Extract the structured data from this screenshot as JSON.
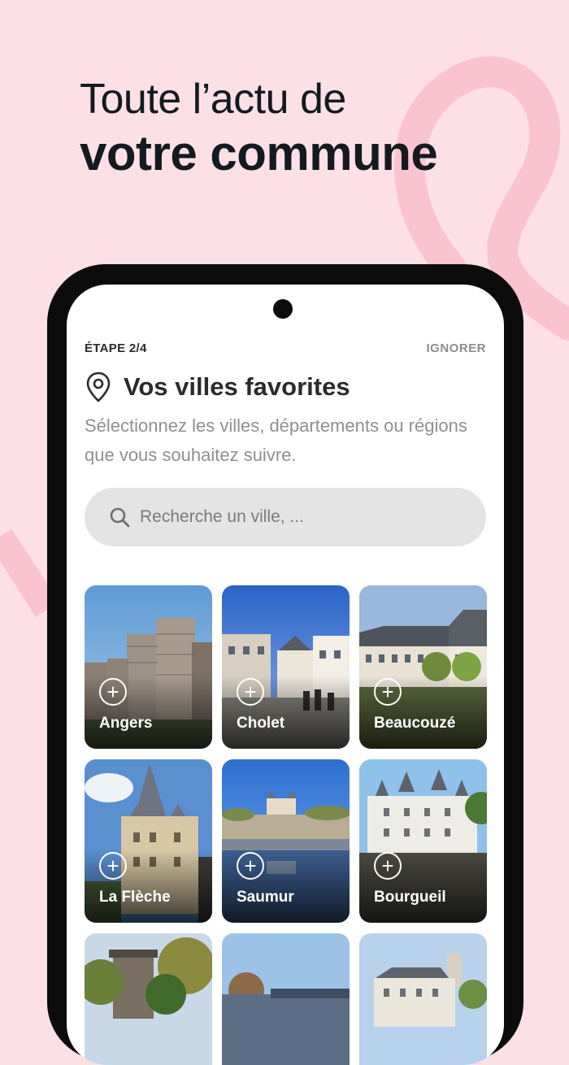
{
  "headline": {
    "line1": "Toute l’actu de",
    "line2": "votre commune"
  },
  "onboarding": {
    "step": "ÉTAPE 2/4",
    "skip": "IGNORER",
    "title": "Vos villes favorites",
    "subtitle": "Sélectionnez les villes, départements ou régions que vous souhaitez suivre."
  },
  "search": {
    "placeholder": "Recherche un ville, ..."
  },
  "cities": [
    {
      "name": "Angers",
      "add": "+"
    },
    {
      "name": "Cholet",
      "add": "+"
    },
    {
      "name": "Beaucouzé",
      "add": "+"
    },
    {
      "name": "La Flèche",
      "add": "+"
    },
    {
      "name": "Saumur",
      "add": "+"
    },
    {
      "name": "Bourgueil",
      "add": "+"
    },
    {
      "name": "",
      "add": ""
    },
    {
      "name": "",
      "add": ""
    },
    {
      "name": "",
      "add": ""
    }
  ],
  "icons": {
    "location": "map-pin-icon",
    "search": "search-icon",
    "add": "plus-circle-icon"
  },
  "colors": {
    "background": "#fde0e6",
    "ribbon": "#f9c4cf",
    "text_dark": "#141a1f",
    "muted": "#8f8f8f",
    "search_bg": "#e4e4e4"
  }
}
